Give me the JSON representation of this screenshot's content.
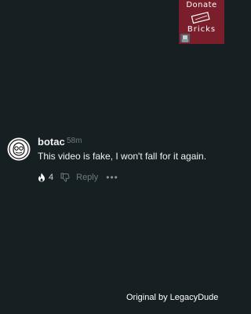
{
  "donate": {
    "line1": "Donate",
    "line2": "Bricks",
    "brick_icon": "brick-icon",
    "background": "#7a1e2c"
  },
  "comment": {
    "username": "botac",
    "timestamp": "58m",
    "text": "This video is fake, I won't fall for it again.",
    "like_count": "4",
    "reply_label": "Reply",
    "icons": [
      "avatar-icon",
      "fire-icon",
      "dislike-icon",
      "more-icon"
    ]
  },
  "footer": {
    "credit": "Original by LegacyDude"
  },
  "colors": {
    "background": "#162022",
    "text": "#f2f2f2",
    "muted": "#6f7a7c"
  }
}
